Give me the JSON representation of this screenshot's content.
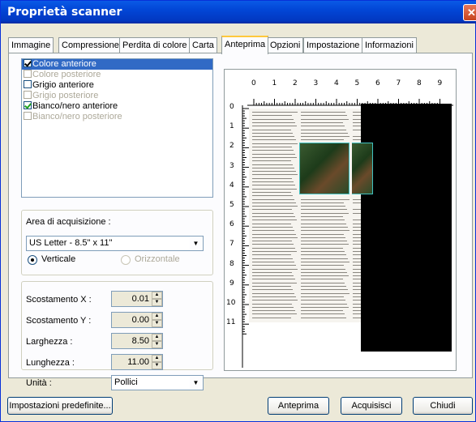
{
  "window": {
    "title": "Proprietà scanner"
  },
  "tabs": [
    {
      "label": "Immagine"
    },
    {
      "label": "Compressione"
    },
    {
      "label": "Perdita di colore"
    },
    {
      "label": "Carta"
    },
    {
      "label": "Anteprima"
    },
    {
      "label": "Opzioni"
    },
    {
      "label": "Impostazione"
    },
    {
      "label": "Informazioni"
    }
  ],
  "active_tab": "Anteprima",
  "image_list": [
    {
      "label": "Colore anteriore",
      "checked": true,
      "enabled": true,
      "selected": true
    },
    {
      "label": "Colore posteriore",
      "checked": false,
      "enabled": false,
      "selected": false
    },
    {
      "label": "Grigio anteriore",
      "checked": false,
      "enabled": true,
      "selected": false
    },
    {
      "label": "Grigio posteriore",
      "checked": false,
      "enabled": false,
      "selected": false
    },
    {
      "label": "Bianco/nero anteriore",
      "checked": true,
      "enabled": true,
      "selected": false
    },
    {
      "label": "Bianco/nero posteriore",
      "checked": false,
      "enabled": false,
      "selected": false
    }
  ],
  "area": {
    "label": "Area di acquisizione :",
    "value": "US Letter - 8.5\" x 11\"",
    "orientation": {
      "vertical_label": "Verticale",
      "horizontal_label": "Orizzontale",
      "selected": "Verticale"
    }
  },
  "fields": {
    "offset_x": {
      "label": "Scostamento X :",
      "value": "0.01"
    },
    "offset_y": {
      "label": "Scostamento Y :",
      "value": "0.00"
    },
    "width": {
      "label": "Larghezza :",
      "value": "8.50"
    },
    "length": {
      "label": "Lunghezza :",
      "value": "11.00"
    },
    "unit": {
      "label": "Unità :",
      "value": "Pollici"
    }
  },
  "ruler": {
    "top": [
      "0",
      "1",
      "2",
      "3",
      "4",
      "5",
      "6",
      "7",
      "8",
      "9"
    ],
    "left": [
      "0",
      "1",
      "2",
      "3",
      "4",
      "5",
      "6",
      "7",
      "8",
      "9",
      "10",
      "11"
    ]
  },
  "buttons": {
    "defaults": "Impostazioni predefinite...",
    "preview": "Anteprima",
    "scan": "Acquisisci",
    "close": "Chiudi"
  },
  "colors": {
    "title_bar": "#0246d6",
    "selection": "#316ac5",
    "active_tab_accent": "#ffc83c"
  }
}
